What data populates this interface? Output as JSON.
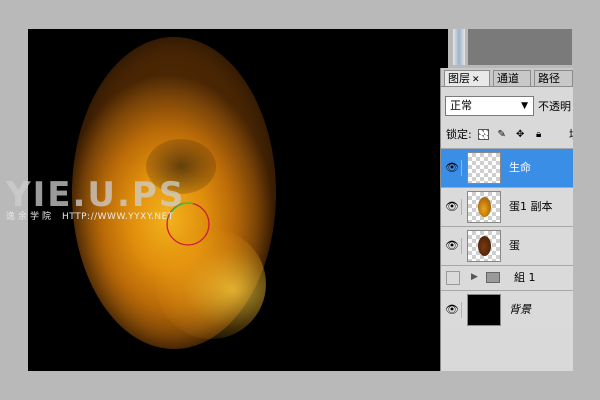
{
  "watermark": {
    "brand": "YIE.U.PS",
    "sub_cn": "逸余学院",
    "url": "HTTP://WWW.YYXY.NET"
  },
  "layers_panel": {
    "tabs": [
      {
        "label": "图层",
        "active": true,
        "has_close": true
      },
      {
        "label": "通道",
        "active": false
      },
      {
        "label": "路径",
        "active": false
      }
    ],
    "blend_mode": "正常",
    "opacity_label": "不透明",
    "lock_label": "锁定:",
    "fill_label": "填",
    "layers": [
      {
        "name": "生命",
        "visible": true,
        "selected": true,
        "thumb": "transparent"
      },
      {
        "name": "蛋1 副本",
        "visible": true,
        "selected": false,
        "thumb": "orange-egg"
      },
      {
        "name": "蛋",
        "visible": true,
        "selected": false,
        "thumb": "brown-egg"
      },
      {
        "name": "組 1",
        "visible": false,
        "selected": false,
        "thumb": "folder",
        "group": true
      },
      {
        "name": "背景",
        "visible": true,
        "selected": false,
        "thumb": "black",
        "italic": true
      }
    ]
  },
  "colors": {
    "selection": "#3b8ee6",
    "egg_core": "#f4b21c",
    "egg_edge": "#7a4408"
  },
  "icons": {
    "close": "close-icon",
    "dropdown": "chevron-down-icon",
    "eye": "eye-icon",
    "folder": "folder-icon",
    "expand": "triangle-right-icon"
  }
}
